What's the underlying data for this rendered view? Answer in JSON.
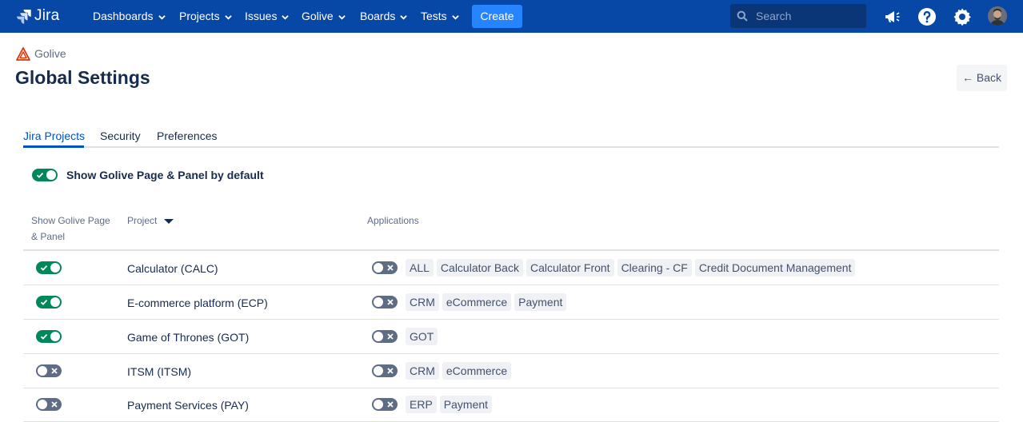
{
  "nav": {
    "logo_text": "Jira",
    "menus": [
      {
        "label": "Dashboards"
      },
      {
        "label": "Projects"
      },
      {
        "label": "Issues"
      },
      {
        "label": "Golive"
      },
      {
        "label": "Boards"
      },
      {
        "label": "Tests"
      }
    ],
    "create_label": "Create",
    "search_placeholder": "Search",
    "icons": [
      "megaphone-icon",
      "help-icon",
      "settings-icon",
      "avatar"
    ],
    "colors": {
      "bar": "#0747a6",
      "create": "#2684ff"
    }
  },
  "header": {
    "breadcrumb": "Golive",
    "title": "Global Settings",
    "back_label": "Back"
  },
  "tabs": [
    {
      "label": "Jira Projects",
      "active": true
    },
    {
      "label": "Security",
      "active": false
    },
    {
      "label": "Preferences",
      "active": false
    }
  ],
  "default_toggle": {
    "label": "Show Golive Page & Panel by default",
    "on": true
  },
  "table": {
    "headers": {
      "show_line1": "Show Golive Page",
      "show_line2": "& Panel",
      "project": "Project",
      "applications": "Applications"
    },
    "rows": [
      {
        "enabled": true,
        "project": "Calculator (CALC)",
        "apps_toggle": false,
        "apps": [
          "ALL",
          "Calculator Back",
          "Calculator Front",
          "Clearing - CF",
          "Credit Document Management"
        ]
      },
      {
        "enabled": true,
        "project": "E-commerce platform (ECP)",
        "apps_toggle": false,
        "apps": [
          "CRM",
          "eCommerce",
          "Payment"
        ]
      },
      {
        "enabled": true,
        "project": "Game of Thrones (GOT)",
        "apps_toggle": false,
        "apps": [
          "GOT"
        ]
      },
      {
        "enabled": false,
        "project": "ITSM (ITSM)",
        "apps_toggle": false,
        "apps": [
          "CRM",
          "eCommerce"
        ]
      },
      {
        "enabled": false,
        "project": "Payment Services (PAY)",
        "apps_toggle": false,
        "apps": [
          "ERP",
          "Payment"
        ]
      }
    ]
  },
  "colors": {
    "toggle_on": "#00875a",
    "toggle_off": "#5e6c84",
    "accent": "#0052cc"
  }
}
